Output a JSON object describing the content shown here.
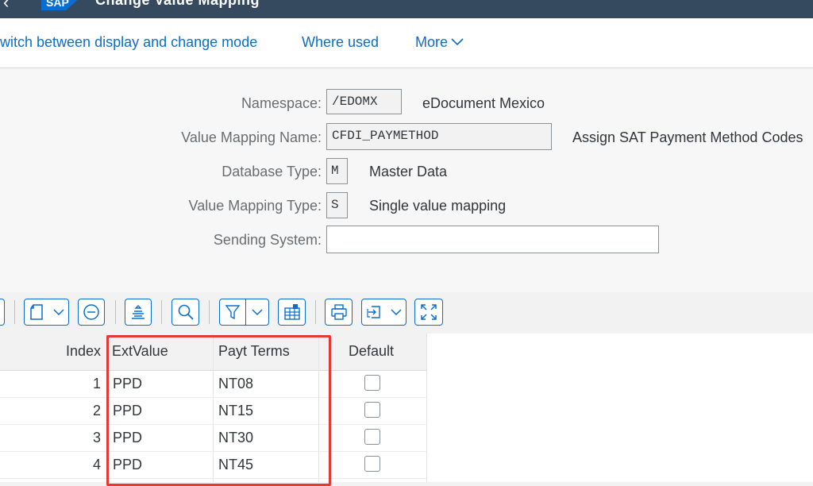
{
  "shell": {
    "title": "Change Value Mapping",
    "logo_text": "SAP"
  },
  "toolbar": {
    "switch_label": "witch between display and change mode",
    "where_used_label": "Where used",
    "more_label": "More"
  },
  "form": {
    "namespace": {
      "label": "Namespace:",
      "value": "/EDOMX",
      "desc": "eDocument Mexico"
    },
    "mapping_name": {
      "label": "Value Mapping Name:",
      "value": "CFDI_PAYMETHOD",
      "desc": "Assign SAT Payment Method Codes"
    },
    "db_type": {
      "label": "Database Type:",
      "value": "M",
      "desc": "Master Data"
    },
    "mapping_type": {
      "label": "Value Mapping Type:",
      "value": "S",
      "desc": "Single value mapping"
    },
    "sending_system": {
      "label": "Sending System:",
      "value": ""
    }
  },
  "table": {
    "columns": {
      "index": "Index",
      "ext_value": "ExtValue",
      "payt_terms": "Payt Terms",
      "default": "Default"
    },
    "rows": [
      {
        "index": "1",
        "ext_value": "PPD",
        "payt_terms": "NT08",
        "default": false
      },
      {
        "index": "2",
        "ext_value": "PPD",
        "payt_terms": "NT15",
        "default": false
      },
      {
        "index": "3",
        "ext_value": "PPD",
        "payt_terms": "NT30",
        "default": false
      },
      {
        "index": "4",
        "ext_value": "PPD",
        "payt_terms": "NT45",
        "default": false
      }
    ]
  },
  "icons": [
    "back-icon",
    "sap-logo",
    "chevron-down-icon",
    "document-icon",
    "minus-circle-icon",
    "align-icon",
    "search-icon",
    "filter-icon",
    "table-settings-icon",
    "print-icon",
    "export-icon",
    "fullscreen-icon"
  ],
  "colors": {
    "shell": "#354a5f",
    "accent": "#0a6ed1",
    "highlight": "#e53935"
  }
}
